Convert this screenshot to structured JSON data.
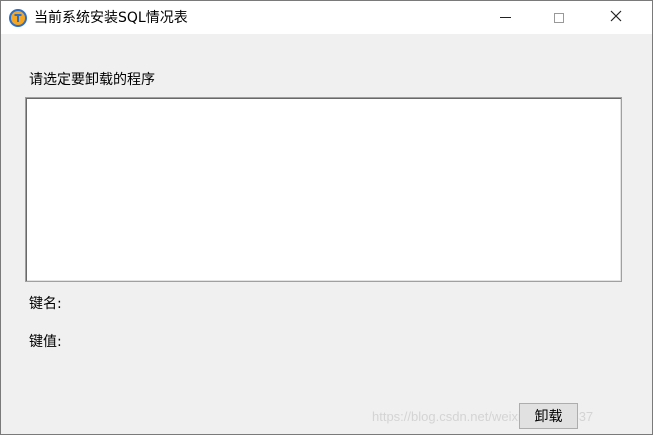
{
  "window": {
    "title": "当前系统安装SQL情况表",
    "icon": "app-logo-icon",
    "controls": {
      "minimize": "minimize-icon",
      "maximize": "maximize-icon",
      "close": "close-icon"
    }
  },
  "main": {
    "prompt": "请选定要卸载的程序",
    "program_list": [],
    "key_name_label": "键名:",
    "key_value_label": "键值:",
    "uninstall_label": "卸载"
  },
  "watermark": "https://blog.csdn.net/weixin_43814837",
  "colors": {
    "background": "#f0f0f0",
    "titlebar": "#ffffff",
    "icon_ring": "#2a6fc9",
    "icon_fill": "#f5a623"
  }
}
